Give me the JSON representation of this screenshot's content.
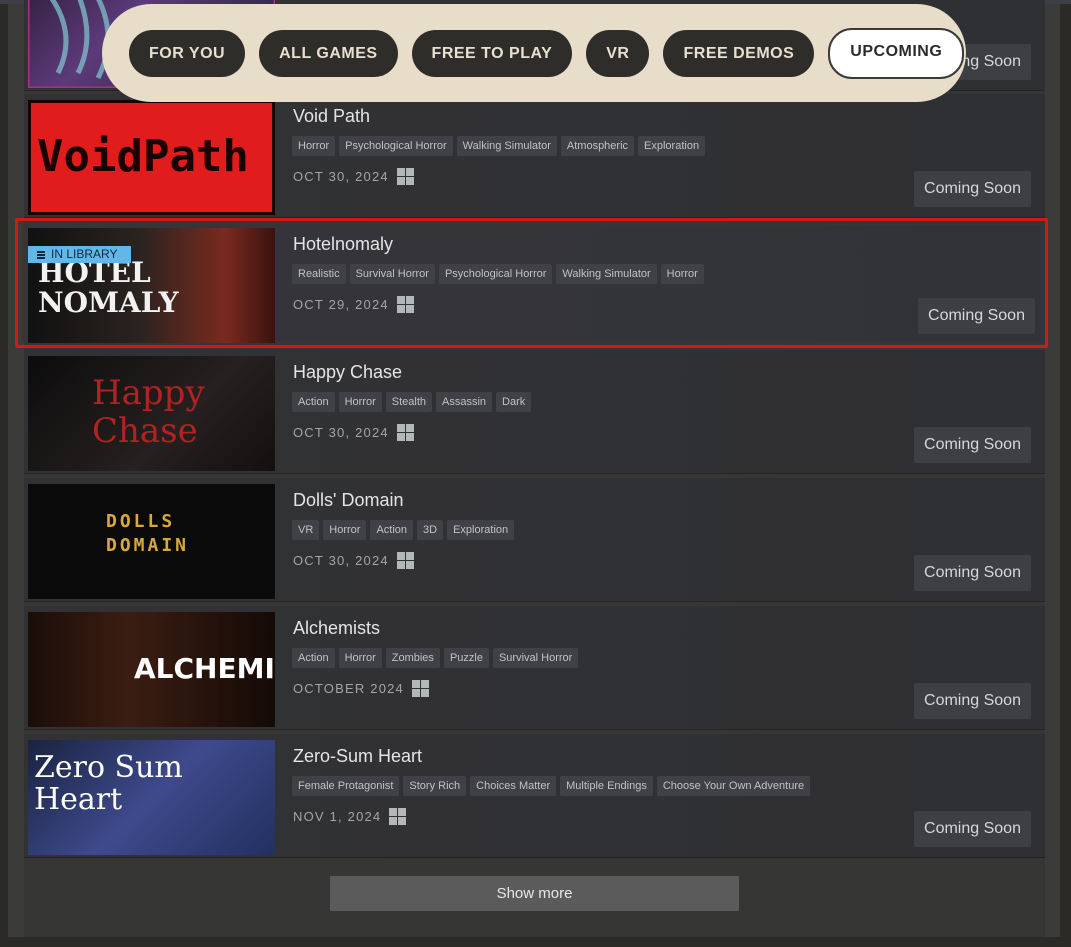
{
  "nav": {
    "tabs": [
      {
        "label": "FOR YOU"
      },
      {
        "label": "ALL GAMES"
      },
      {
        "label": "FREE TO PLAY"
      },
      {
        "label": "VR"
      },
      {
        "label": "FREE DEMOS"
      },
      {
        "label": "UPCOMING",
        "active": true
      }
    ]
  },
  "partial_row": {
    "status": "Coming Soon"
  },
  "games": [
    {
      "title": "Void Path",
      "tags": [
        "Horror",
        "Psychological Horror",
        "Walking Simulator",
        "Atmospheric",
        "Exploration"
      ],
      "date": "OCT 30, 2024",
      "status": "Coming Soon",
      "thumb_text": "VoidPath",
      "platform_icon": "windows-icon"
    },
    {
      "title": "Hotelnomaly",
      "tags": [
        "Realistic",
        "Survival Horror",
        "Psychological Horror",
        "Walking Simulator",
        "Horror"
      ],
      "date": "OCT 29, 2024",
      "status": "Coming Soon",
      "badge": "IN LIBRARY",
      "thumb_text": "HOTEL NOMALY",
      "highlighted": true,
      "platform_icon": "windows-icon"
    },
    {
      "title": "Happy Chase",
      "tags": [
        "Action",
        "Horror",
        "Stealth",
        "Assassin",
        "Dark"
      ],
      "date": "OCT 30, 2024",
      "status": "Coming Soon",
      "thumb_text": "Happy Chase",
      "platform_icon": "windows-icon"
    },
    {
      "title": "Dolls' Domain",
      "tags": [
        "VR",
        "Horror",
        "Action",
        "3D",
        "Exploration"
      ],
      "date": "OCT 30, 2024",
      "status": "Coming Soon",
      "thumb_text": "DOLLS DOMAIN",
      "platform_icon": "windows-icon"
    },
    {
      "title": "Alchemists",
      "tags": [
        "Action",
        "Horror",
        "Zombies",
        "Puzzle",
        "Survival Horror"
      ],
      "date": "OCTOBER 2024",
      "status": "Coming Soon",
      "thumb_text": "ALCHEMISTS",
      "platform_icon": "windows-icon"
    },
    {
      "title": "Zero-Sum Heart",
      "tags": [
        "Female Protagonist",
        "Story Rich",
        "Choices Matter",
        "Multiple Endings",
        "Choose Your Own Adventure"
      ],
      "date": "NOV 1, 2024",
      "status": "Coming Soon",
      "thumb_text": "Zero Sum Heart",
      "platform_icon": "windows-icon"
    }
  ],
  "show_more": "Show more",
  "colors": {
    "highlight": "#d41818",
    "library_badge": "#62b7e8",
    "nav_bg": "#e7ddc9"
  }
}
